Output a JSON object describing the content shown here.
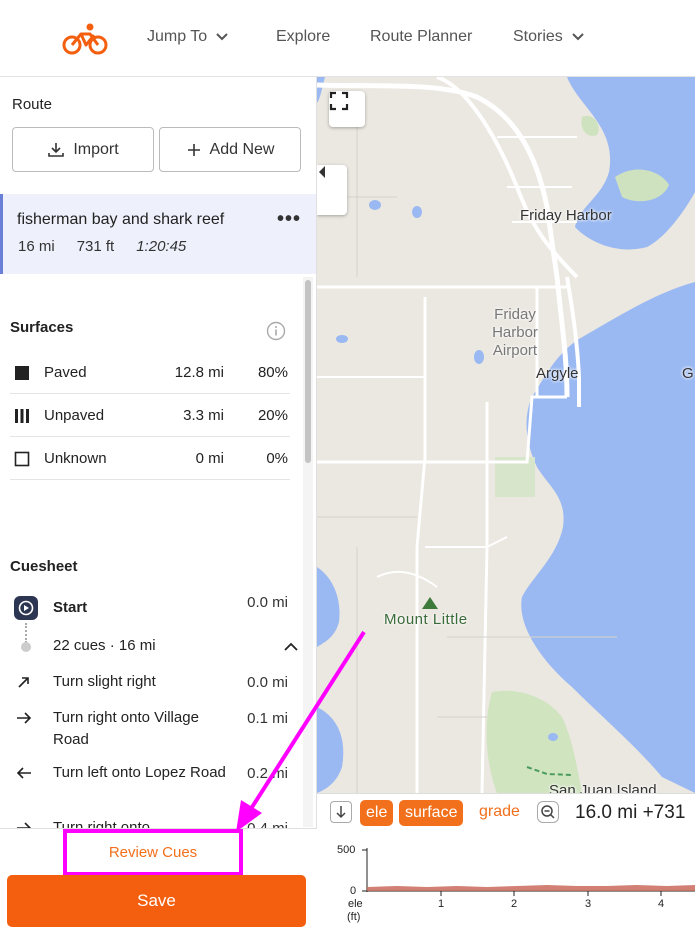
{
  "nav": {
    "items": [
      {
        "label": "Jump To",
        "has_chevron": true
      },
      {
        "label": "Explore",
        "has_chevron": false
      },
      {
        "label": "Route Planner",
        "has_chevron": false
      },
      {
        "label": "Stories",
        "has_chevron": true
      }
    ]
  },
  "sidebar": {
    "route_label": "Route",
    "import_label": "Import",
    "add_new_label": "Add New",
    "route": {
      "name": "fisherman bay and shark reef",
      "distance": "16 mi",
      "elevation": "731 ft",
      "time": "1:20:45"
    },
    "surfaces": {
      "title": "Surfaces",
      "rows": [
        {
          "name": "Paved",
          "distance": "12.8 mi",
          "percent": "80%",
          "icon": "square-filled-icon"
        },
        {
          "name": "Unpaved",
          "distance": "3.3 mi",
          "percent": "20%",
          "icon": "unpaved-bars-icon"
        },
        {
          "name": "Unknown",
          "distance": "0 mi",
          "percent": "0%",
          "icon": "square-outline-icon"
        }
      ]
    },
    "cuesheet": {
      "title": "Cuesheet",
      "start_label": "Start",
      "start_dist": "0.0 mi",
      "summary": "22 cues · 16 mi",
      "cues": [
        {
          "text": "Turn slight right",
          "dist": "0.0 mi",
          "icon": "slight-right-arrow-icon"
        },
        {
          "text": "Turn right onto Village Road",
          "dist": "0.1 mi",
          "icon": "right-arrow-icon"
        },
        {
          "text": "Turn left onto Lopez Road",
          "dist": "0.2 mi",
          "icon": "left-arrow-icon"
        },
        {
          "text": "Turn right onto",
          "dist": "0.4 mi",
          "icon": "right-arrow-icon"
        }
      ]
    },
    "review_cues_label": "Review Cues",
    "save_label": "Save"
  },
  "map": {
    "labels": {
      "friday_harbor": "Friday Harbor",
      "airport": "Friday Harbor Airport",
      "argyle": "Argyle",
      "mount_little": "Mount Little",
      "san_juan": "San Juan Island",
      "edge": "G"
    }
  },
  "elevation": {
    "tabs": {
      "ele": "ele",
      "surface": "surface",
      "grade": "grade"
    },
    "summary": "16.0 mi +731",
    "y_ticks": [
      "500",
      "0"
    ],
    "x_ticks": [
      "1",
      "2",
      "3",
      "4"
    ],
    "y_label_1": "ele",
    "y_label_2": "(ft)"
  },
  "colors": {
    "accent": "#f45f0f",
    "highlight": "#ff00ff",
    "water": "#9ab9f2",
    "land": "#ebe7e1"
  }
}
